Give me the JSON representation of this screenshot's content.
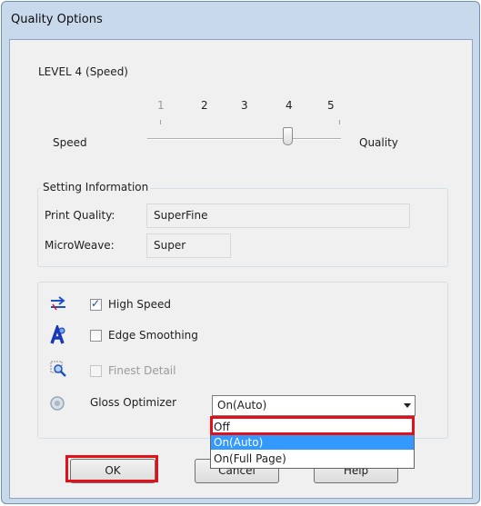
{
  "window": {
    "title": "Quality Options"
  },
  "level": {
    "label": "LEVEL 4 (Speed)"
  },
  "slider": {
    "ticks": [
      "1",
      "2",
      "3",
      "4",
      "5"
    ],
    "value": 4,
    "min_label": "Speed",
    "max_label": "Quality"
  },
  "setting_info": {
    "legend": "Setting Information",
    "print_quality_label": "Print Quality:",
    "print_quality_value": "SuperFine",
    "microweave_label": "MicroWeave:",
    "microweave_value": "Super"
  },
  "options": {
    "high_speed": {
      "label": "High Speed",
      "checked": true
    },
    "edge_smoothing": {
      "label": "Edge Smoothing",
      "checked": false
    },
    "finest_detail": {
      "label": "Finest Detail",
      "checked": false,
      "enabled": false
    },
    "gloss_optimizer": {
      "label": "Gloss Optimizer",
      "selected": "On(Auto)",
      "dropdown_items": [
        "Off",
        "On(Auto)",
        "On(Full Page)"
      ],
      "highlighted_item": "On(Auto)"
    }
  },
  "buttons": {
    "ok": "OK",
    "cancel": "Cancel",
    "help": "Help"
  },
  "colors": {
    "highlight_frame": "#e3101a",
    "selection": "#3399ff"
  }
}
